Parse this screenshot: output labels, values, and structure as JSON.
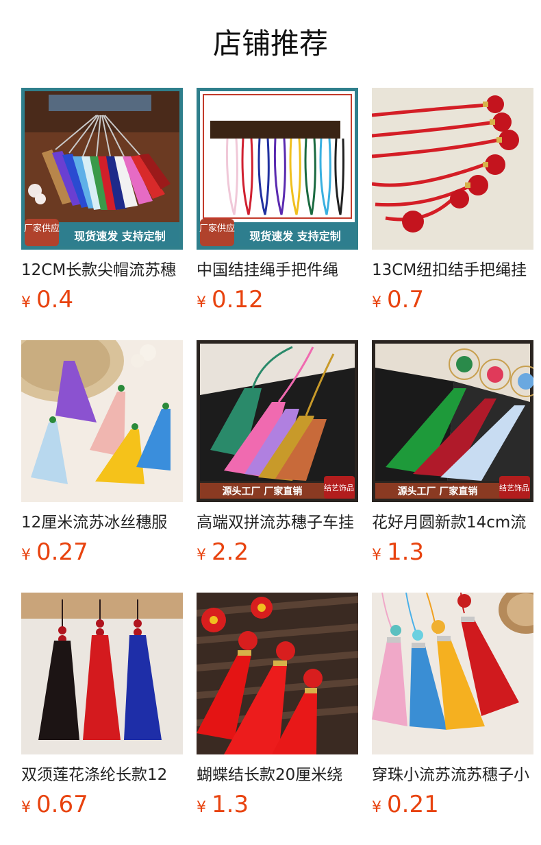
{
  "section": {
    "title": "店铺推荐"
  },
  "currency_symbol": "¥",
  "products": [
    {
      "name": "12CM长款尖帽流苏穗",
      "price": "0.4",
      "badge": {
        "corner": "厂家供应",
        "text": "现货速发 支持定制"
      }
    },
    {
      "name": "中国结挂绳手把件绳",
      "price": "0.12",
      "badge": {
        "corner": "厂家供应",
        "text": "现货速发 支持定制"
      }
    },
    {
      "name": "13CM纽扣结手把绳挂",
      "price": "0.7"
    },
    {
      "name": "12厘米流苏冰丝穗服",
      "price": "0.27"
    },
    {
      "name": "高端双拼流苏穗子车挂",
      "price": "2.2",
      "badge": {
        "text": "源头工厂 厂家直销",
        "corner": "结艺饰品"
      }
    },
    {
      "name": "花好月圆新款14cm流",
      "price": "1.3",
      "badge": {
        "text": "源头工厂 厂家直销",
        "corner": "结艺饰品"
      }
    },
    {
      "name": "双须莲花涤纶长款12",
      "price": "0.67"
    },
    {
      "name": "蝴蝶结长款20厘米绕",
      "price": "1.3"
    },
    {
      "name": "穿珠小流苏流苏穗子小",
      "price": "0.21"
    }
  ]
}
